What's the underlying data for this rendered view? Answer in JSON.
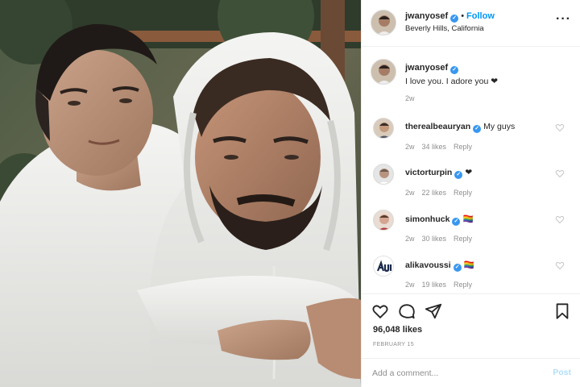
{
  "post": {
    "username": "jwanyosef",
    "follow_label": "Follow",
    "location": "Beverly Hills, California",
    "more_icon": "more-horizontal-icon"
  },
  "caption": {
    "username": "jwanyosef",
    "text": "I love you. I adore you ❤",
    "time": "2w"
  },
  "comments": [
    {
      "username": "therealbeauryan",
      "text": "My guys",
      "time": "2w",
      "likes": "34 likes",
      "reply": "Reply"
    },
    {
      "username": "victorturpin",
      "text": "❤",
      "time": "2w",
      "likes": "22 likes",
      "reply": "Reply"
    },
    {
      "username": "simonhuck",
      "text": "🏳️‍🌈",
      "time": "2w",
      "likes": "30 likes",
      "reply": "Reply"
    },
    {
      "username": "alikavoussi",
      "text": "🏳️‍🌈",
      "time": "2w",
      "likes": "19 likes",
      "reply": "Reply"
    }
  ],
  "actions": {
    "icons": [
      "heart-icon",
      "comment-icon",
      "share-icon",
      "bookmark-icon"
    ],
    "likes": "96,048 likes",
    "date": "FEBRUARY 15"
  },
  "comment_box": {
    "placeholder": "Add a comment...",
    "post_label": "Post"
  },
  "colors": {
    "link": "#0095f6",
    "verified": "#3897f0",
    "muted": "#8e8e8e",
    "post_disabled": "#b2dffc"
  }
}
